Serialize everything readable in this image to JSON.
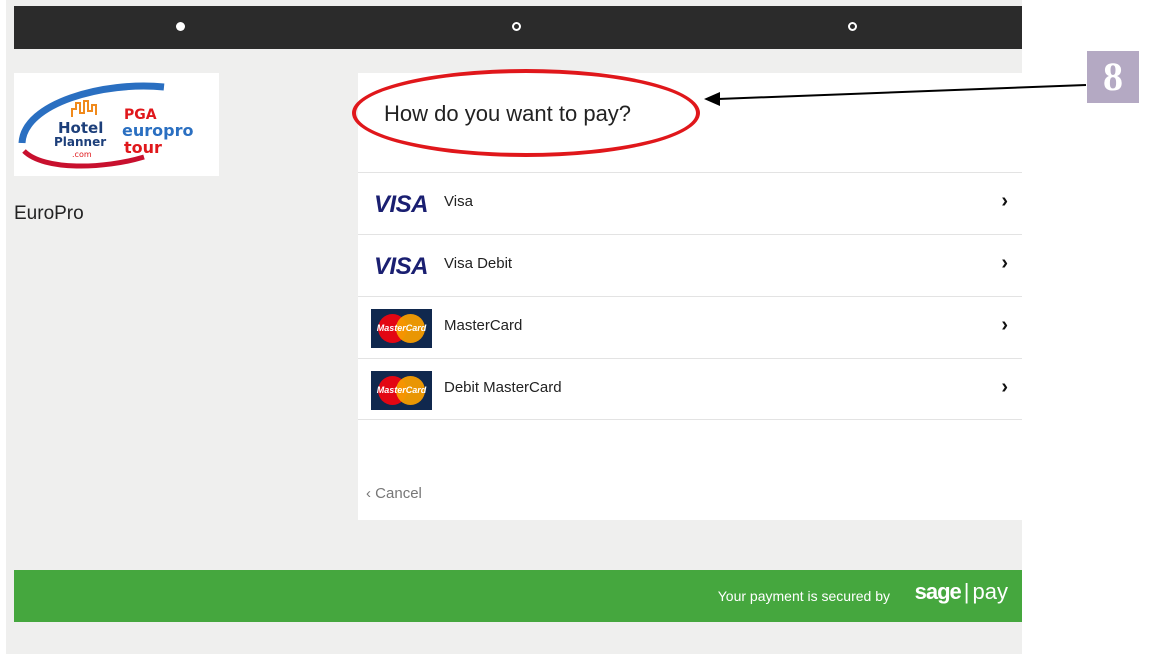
{
  "progress": {
    "steps": 3,
    "active_step": 1
  },
  "merchant": {
    "logo_text": {
      "brand1_line1": "Hotel",
      "brand1_line2": "Planner",
      "brand1_line3": ".com",
      "brand2_top": "PGA",
      "brand2_line1": "europro",
      "brand2_line2": "tour"
    },
    "name": "EuroPro"
  },
  "payment": {
    "title": "How do you want to pay?",
    "methods": [
      {
        "label": "Visa",
        "logo": "visa-logo"
      },
      {
        "label": "Visa Debit",
        "logo": "visa-logo"
      },
      {
        "label": "MasterCard",
        "logo": "mastercard-logo"
      },
      {
        "label": "Debit MasterCard",
        "logo": "mastercard-logo"
      }
    ],
    "visa_logo_text": "VISA",
    "mastercard_logo_text": "MasterCard",
    "chevron": "›",
    "cancel_label": "Cancel",
    "cancel_icon": "‹"
  },
  "footer": {
    "secured_text": "Your payment is secured by",
    "logo_sage": "sage",
    "logo_divider": "|",
    "logo_pay": "pay"
  },
  "annotation": {
    "step_number": "8"
  },
  "colors": {
    "progress_bar": "#2b2b2b",
    "footer_green": "#45a73e",
    "highlight_red": "#e0171b",
    "badge": "#b4a9c3"
  }
}
